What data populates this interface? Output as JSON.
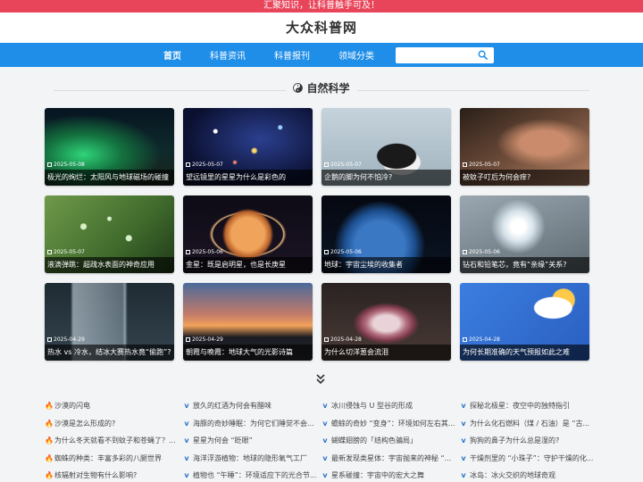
{
  "topbar": {
    "text": "汇聚知识，让科普触手可及！"
  },
  "brand": {
    "name": "大众科普网"
  },
  "nav": {
    "items": [
      {
        "label": "首页",
        "active": true
      },
      {
        "label": "科普资讯",
        "active": false
      },
      {
        "label": "科普报刊",
        "active": false
      },
      {
        "label": "领域分类",
        "active": false
      }
    ],
    "search_placeholder": ""
  },
  "section": {
    "title": "自然科学",
    "icon": "yin-yang-icon"
  },
  "cards": [
    {
      "date": "2025-05-08",
      "title": "极光的绚烂：太阳风与地球磁场的碰撞",
      "scene": "aurora"
    },
    {
      "date": "2025-05-07",
      "title": "望远镜里的星星为什么是彩色的",
      "scene": "stars"
    },
    {
      "date": "2025-05-07",
      "title": "企鹅的脚为何不怕冷?",
      "scene": "penguin"
    },
    {
      "date": "2025-05-07",
      "title": "被蚊子叮后为何会痒?",
      "scene": "mosquito"
    },
    {
      "date": "2025-05-07",
      "title": "液滴弹跳：超疏水表面的神奇应用",
      "scene": "leaf"
    },
    {
      "date": "2025-05-06",
      "title": "金星：既是启明星，也是长庚星",
      "scene": "venus"
    },
    {
      "date": "2025-05-06",
      "title": "地球：宇宙尘埃的收集者",
      "scene": "earth"
    },
    {
      "date": "2025-05-06",
      "title": "钻石和铅笔芯，竟有“亲缘”关系?",
      "scene": "diamond"
    },
    {
      "date": "2025-04-29",
      "title": "热水 vs 冷水，结冰大赛热水竟“偷跑”?",
      "scene": "water"
    },
    {
      "date": "2025-04-29",
      "title": "朝霞与晚霞：地球大气的光影诗篇",
      "scene": "sunset"
    },
    {
      "date": "2025-04-28",
      "title": "为什么切洋葱会流泪",
      "scene": "onion"
    },
    {
      "date": "2025-04-28",
      "title": "为何长期准确的天气预报如此之难",
      "scene": "weather"
    }
  ],
  "more_icon": "double-chevron-down-icon",
  "list": [
    {
      "icon": "fire",
      "text": "沙漠的闪电"
    },
    {
      "icon": "v",
      "text": "放久的红酒为何会有醋味"
    },
    {
      "icon": "v",
      "text": "冰川侵蚀与 U 型谷的形成"
    },
    {
      "icon": "v",
      "text": "探秘北极星：夜空中的独特指引"
    },
    {
      "icon": "fire",
      "text": "沙漠是怎么形成的?"
    },
    {
      "icon": "v",
      "text": "海豚的奇妙睡眠：为何它们睡觉不会..."
    },
    {
      "icon": "v",
      "text": "蟾蜍的奇妙 “变身”：环境如何左右其..."
    },
    {
      "icon": "v",
      "text": "为什么化石燃料（煤 / 石油）是 “古..."
    },
    {
      "icon": "fire",
      "text": "为什么冬天就看不到蚊子和苍蝇了？..."
    },
    {
      "icon": "v",
      "text": "星星为何会 “眨眼”"
    },
    {
      "icon": "v",
      "text": "蝴蝶翅膀的「结构色骗局」"
    },
    {
      "icon": "v",
      "text": "狗狗的鼻子为什么总是湿的?"
    },
    {
      "icon": "fire",
      "text": "蜘蛛的种类：丰富多彩的八腿世界"
    },
    {
      "icon": "v",
      "text": "海洋浮游植物：地球的隐形氧气工厂"
    },
    {
      "icon": "v",
      "text": "最新发现类星体：宇宙抛来的神秘 “..."
    },
    {
      "icon": "v",
      "text": "干燥剂里的 “小珠子”：守护干燥的化..."
    },
    {
      "icon": "fire",
      "text": "核辐射对生物有什么影响?"
    },
    {
      "icon": "v",
      "text": "植物也 “午睡”：环境适应下的光合节..."
    },
    {
      "icon": "v",
      "text": "星系碰撞：宇宙中的宏大之舞"
    },
    {
      "icon": "v",
      "text": "冰岛：冰火交织的地球奇观"
    }
  ],
  "colors": {
    "topbar": "#e8455b",
    "nav": "#1f8ee8",
    "page_bg": "#f3f4f6"
  }
}
